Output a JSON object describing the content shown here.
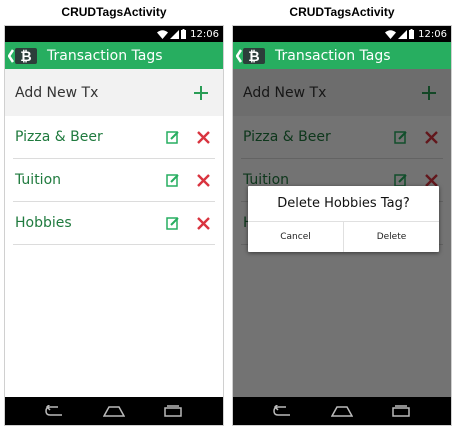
{
  "captions": {
    "left": "CRUDTagsActivity",
    "right": "CRUDTagsActivity"
  },
  "status": {
    "time": "12:06"
  },
  "appbar": {
    "title": "Transaction Tags"
  },
  "add_row": {
    "label": "Add New Tx",
    "plus": "+"
  },
  "tags": [
    {
      "name": "Pizza & Beer"
    },
    {
      "name": "Tuition"
    },
    {
      "name": "Hobbies"
    }
  ],
  "dialog": {
    "title": "Delete Hobbies Tag?",
    "cancel": "Cancel",
    "delete": "Delete"
  },
  "colors": {
    "accent": "#27ae60",
    "delete": "#d9343f",
    "tag_text": "#1f7a3e"
  },
  "icons": [
    "wifi-icon",
    "signal-icon",
    "battery-icon",
    "bitcoin-logo-icon",
    "plus-icon",
    "edit-icon",
    "delete-x-icon",
    "back-icon",
    "home-icon",
    "recents-icon"
  ]
}
